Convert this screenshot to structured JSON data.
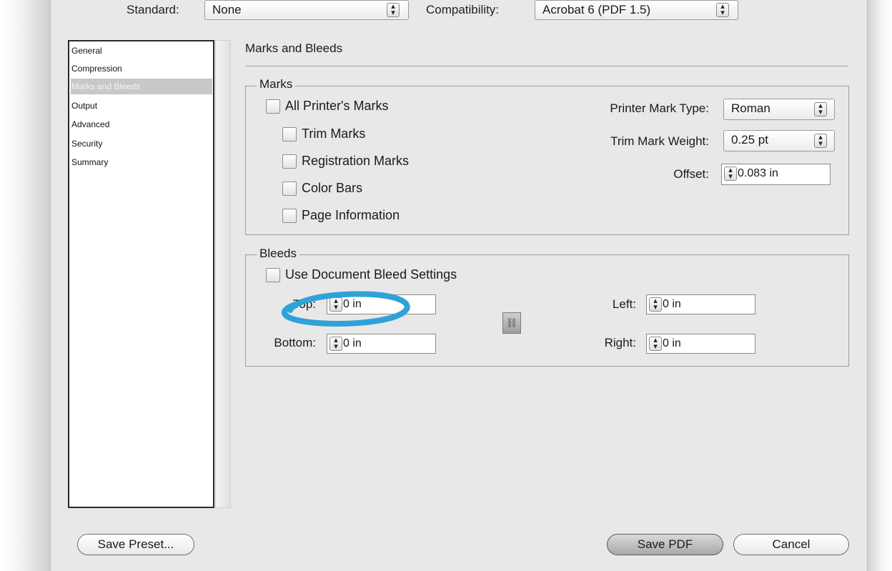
{
  "header": {
    "standard_label": "Standard:",
    "standard_value": "None",
    "compatibility_label": "Compatibility:",
    "compatibility_value": "Acrobat 6 (PDF 1.5)"
  },
  "sidebar": {
    "items": [
      {
        "label": "General"
      },
      {
        "label": "Compression"
      },
      {
        "label": "Marks and Bleeds"
      },
      {
        "label": "Output"
      },
      {
        "label": "Advanced"
      },
      {
        "label": "Security"
      },
      {
        "label": "Summary"
      }
    ],
    "selected": "Marks and Bleeds"
  },
  "panel": {
    "title": "Marks and Bleeds"
  },
  "marks": {
    "group_label": "Marks",
    "all_printers_marks": "All Printer's Marks",
    "trim_marks": "Trim Marks",
    "registration_marks": "Registration Marks",
    "color_bars": "Color Bars",
    "page_information": "Page Information",
    "printer_mark_type_label": "Printer Mark Type:",
    "printer_mark_type_value": "Roman",
    "trim_mark_weight_label": "Trim Mark Weight:",
    "trim_mark_weight_value": "0.25 pt",
    "offset_label": "Offset:",
    "offset_value": "0.083 in"
  },
  "bleeds": {
    "group_label": "Bleeds",
    "use_document_bleed": "Use Document Bleed Settings",
    "top_label": "Top:",
    "top_value": "0 in",
    "bottom_label": "Bottom:",
    "bottom_value": "0 in",
    "left_label": "Left:",
    "left_value": "0 in",
    "right_label": "Right:",
    "right_value": "0 in"
  },
  "buttons": {
    "save_preset": "Save Preset...",
    "save_pdf": "Save PDF",
    "cancel": "Cancel"
  },
  "icons": {
    "stepper": "up-down-arrows-icon",
    "chain": "chain-link-icon"
  },
  "colors": {
    "dialog_bg": "#e8e8e8",
    "selection": "#c8c8c8",
    "annotation": "#2fa2d8"
  }
}
